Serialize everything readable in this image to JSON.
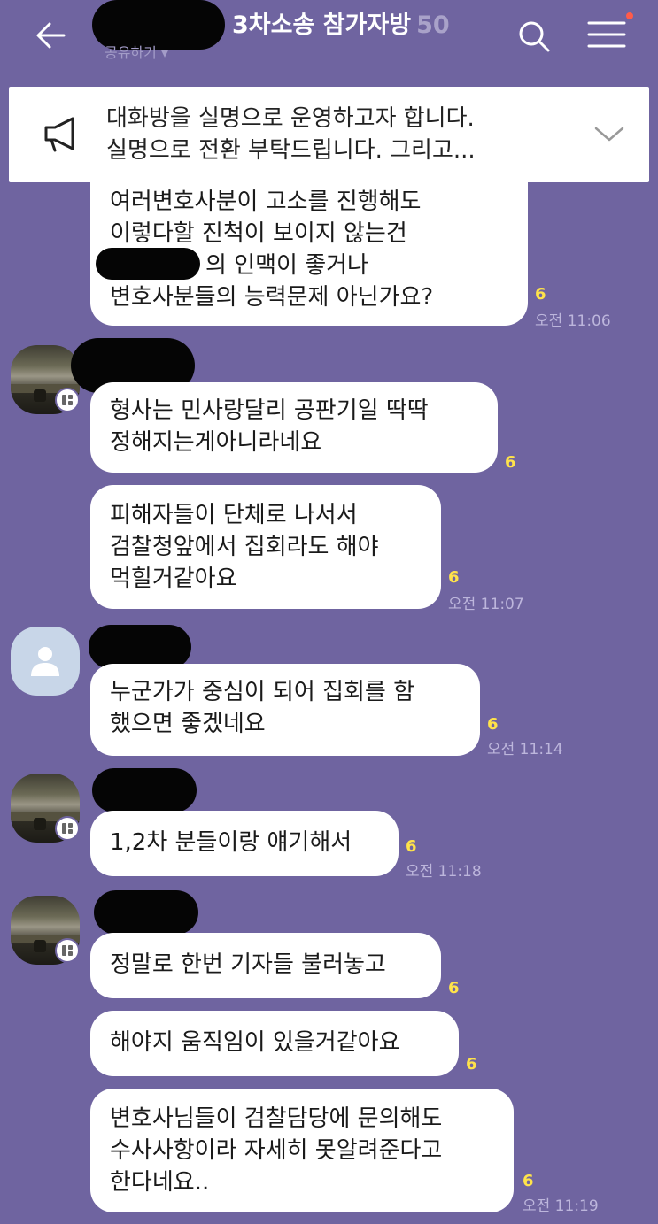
{
  "header": {
    "title": "3차소송 참가자방",
    "member_count": "50",
    "share_label": "공유하기 ▾"
  },
  "notice": {
    "line1": "대화방을 실명으로 운영하고자 합니다.",
    "line2": "실명으로 전환 부탁드립니다. 그리고..."
  },
  "messages": [
    {
      "lines": [
        "여러변호사분이 고소를 진행해도",
        "이렇다할 진척이 보이지 않는건",
        "의 인맥이 좋거나",
        "변호사분들의 능력문제 아닌가요?"
      ],
      "unread": "6",
      "time": "오전 11:06"
    },
    {
      "lines": [
        "형사는 민사랑달리 공판기일 딱딱",
        "정해지는게아니라네요"
      ],
      "unread": "6",
      "time": ""
    },
    {
      "lines": [
        "피해자들이 단체로 나서서",
        "검찰청앞에서 집회라도 해야",
        "먹힐거같아요"
      ],
      "unread": "6",
      "time": "오전 11:07"
    },
    {
      "lines": [
        "누군가가 중심이 되어 집회를 함",
        "했으면 좋겠네요"
      ],
      "unread": "6",
      "time": "오전 11:14"
    },
    {
      "lines": [
        "1,2차 분들이랑 얘기해서"
      ],
      "unread": "6",
      "time": "오전 11:18"
    },
    {
      "lines": [
        "정말로 한번 기자들 불러놓고"
      ],
      "unread": "6",
      "time": ""
    },
    {
      "lines": [
        "해야지 움직임이 있을거같아요"
      ],
      "unread": "6",
      "time": ""
    },
    {
      "lines": [
        "변호사님들이 검찰담당에 문의해도",
        "수사사항이라 자세히 못알려준다고",
        "한다네요.."
      ],
      "unread": "6",
      "time": "오전 11:19"
    }
  ],
  "colors": {
    "background": "#6f64a0",
    "bubble": "#ffffff",
    "unread": "#ffe34a",
    "time": "#bdb6dc",
    "title": "#ffffff",
    "member_count": "#a9a2c9",
    "notification_dot": "#ff5b4a"
  },
  "icons": [
    "back-arrow-icon",
    "search-icon",
    "menu-icon",
    "megaphone-icon",
    "chevron-down-icon",
    "person-icon",
    "profile-badge-icon"
  ]
}
